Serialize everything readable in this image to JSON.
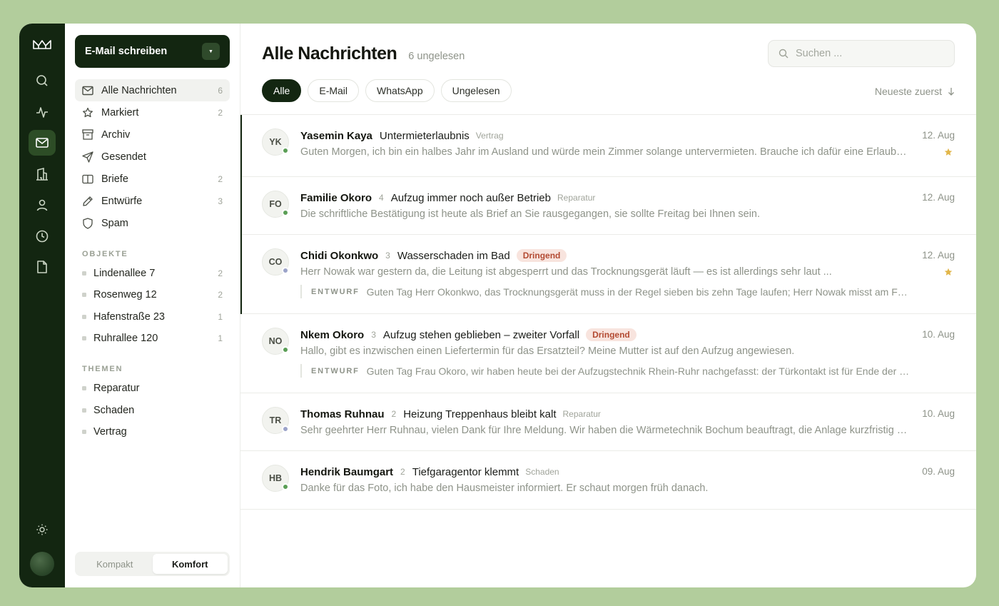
{
  "colors": {
    "accent": "#132611",
    "online": "#5a9e55",
    "away": "#9ba3c9",
    "urgent": "#b34a32",
    "star": "#e2b64a"
  },
  "rail": {
    "items": [
      {
        "icon": "search-icon"
      },
      {
        "icon": "activity-icon"
      },
      {
        "icon": "mail-icon",
        "active": true
      },
      {
        "icon": "building-icon"
      },
      {
        "icon": "user-icon"
      },
      {
        "icon": "clock-icon"
      },
      {
        "icon": "document-icon"
      }
    ]
  },
  "sidebar": {
    "compose_label": "E-Mail schreiben",
    "nav": [
      {
        "label": "Alle Nachrichten",
        "count": "6",
        "icon": "mail-icon"
      },
      {
        "label": "Markiert",
        "count": "2",
        "icon": "star-icon"
      },
      {
        "label": "Archiv",
        "count": "",
        "icon": "archive-icon"
      },
      {
        "label": "Gesendet",
        "count": "",
        "icon": "send-icon"
      },
      {
        "label": "Briefe",
        "count": "2",
        "icon": "letter-icon"
      },
      {
        "label": "Entwürfe",
        "count": "3",
        "icon": "pencil-icon"
      },
      {
        "label": "Spam",
        "count": "",
        "icon": "shield-icon"
      }
    ],
    "objects_title": "OBJEKTE",
    "objects": [
      {
        "label": "Lindenallee 7",
        "count": "2"
      },
      {
        "label": "Rosenweg 12",
        "count": "2"
      },
      {
        "label": "Hafenstraße 23",
        "count": "1"
      },
      {
        "label": "Ruhrallee 120",
        "count": "1"
      }
    ],
    "topics_title": "THEMEN",
    "topics": [
      {
        "label": "Reparatur"
      },
      {
        "label": "Schaden"
      },
      {
        "label": "Vertrag"
      }
    ],
    "density": {
      "compact": "Kompakt",
      "comfort": "Komfort"
    }
  },
  "main": {
    "title": "Alle Nachrichten",
    "unread": "6 ungelesen",
    "search_placeholder": "Suchen ...",
    "filters": [
      "Alle",
      "E-Mail",
      "WhatsApp",
      "Ungelesen"
    ],
    "sort_label": "Neueste zuerst",
    "messages": [
      {
        "initials": "YK",
        "status": "online",
        "sender": "Yasemin Kaya",
        "thread": "",
        "subject": "Untermieterlaubnis",
        "tag": "Vertrag",
        "badge": "",
        "date": "12. Aug",
        "starred": true,
        "unread": true,
        "preview": "Guten Morgen, ich bin ein halbes Jahr im Ausland und würde mein Zimmer solange untervermieten. Brauche ich dafür eine Erlaubnis vom Vermieter?",
        "draft": ""
      },
      {
        "initials": "FO",
        "status": "online",
        "sender": "Familie Okoro",
        "thread": "4",
        "subject": "Aufzug immer noch außer Betrieb",
        "tag": "Reparatur",
        "badge": "",
        "date": "12. Aug",
        "starred": false,
        "unread": true,
        "preview": "Die schriftliche Bestätigung ist heute als Brief an Sie rausgegangen, sie sollte Freitag bei Ihnen sein.",
        "draft": ""
      },
      {
        "initials": "CO",
        "status": "away",
        "sender": "Chidi Okonkwo",
        "thread": "3",
        "subject": "Wasserschaden im Bad",
        "tag": "",
        "badge": "Dringend",
        "date": "12. Aug",
        "starred": true,
        "unread": true,
        "preview": "Herr Nowak war gestern da, die Leitung ist abgesperrt und das Trocknungsgerät läuft — es ist allerdings sehr laut ...",
        "draft_label": "ENTWURF",
        "draft": "Guten Tag Herr Okonkwo, das Trocknungsgerät muss in der Regel sieben bis zehn Tage laufen; Herr Nowak misst am Freitag erneut."
      },
      {
        "initials": "NO",
        "status": "online",
        "sender": "Nkem Okoro",
        "thread": "3",
        "subject": "Aufzug stehen geblieben – zweiter Vorfall",
        "tag": "",
        "badge": "Dringend",
        "date": "10. Aug",
        "starred": false,
        "unread": false,
        "preview": "Hallo, gibt es inzwischen einen Liefertermin für das Ersatzteil? Meine Mutter ist auf den Aufzug angewiesen.",
        "draft_label": "ENTWURF",
        "draft": "Guten Tag Frau Okoro, wir haben heute bei der Aufzugstechnik Rhein-Ruhr nachgefasst: der Türkontakt ist für Ende der Woche angekündigt."
      },
      {
        "initials": "TR",
        "status": "away",
        "sender": "Thomas Ruhnau",
        "thread": "2",
        "subject": "Heizung Treppenhaus bleibt kalt",
        "tag": "Reparatur",
        "badge": "",
        "date": "10. Aug",
        "starred": false,
        "unread": false,
        "preview": "Sehr geehrter Herr Ruhnau, vielen Dank für Ihre Meldung. Wir haben die Wärmetechnik Bochum beauftragt, die Anlage kurzfristig zu prüfen.",
        "draft": ""
      },
      {
        "initials": "HB",
        "status": "online",
        "sender": "Hendrik Baumgart",
        "thread": "2",
        "subject": "Tiefgaragentor klemmt",
        "tag": "Schaden",
        "badge": "",
        "date": "09. Aug",
        "starred": false,
        "unread": false,
        "preview": "Danke für das Foto, ich habe den Hausmeister informiert. Er schaut morgen früh danach.",
        "draft": ""
      }
    ]
  }
}
